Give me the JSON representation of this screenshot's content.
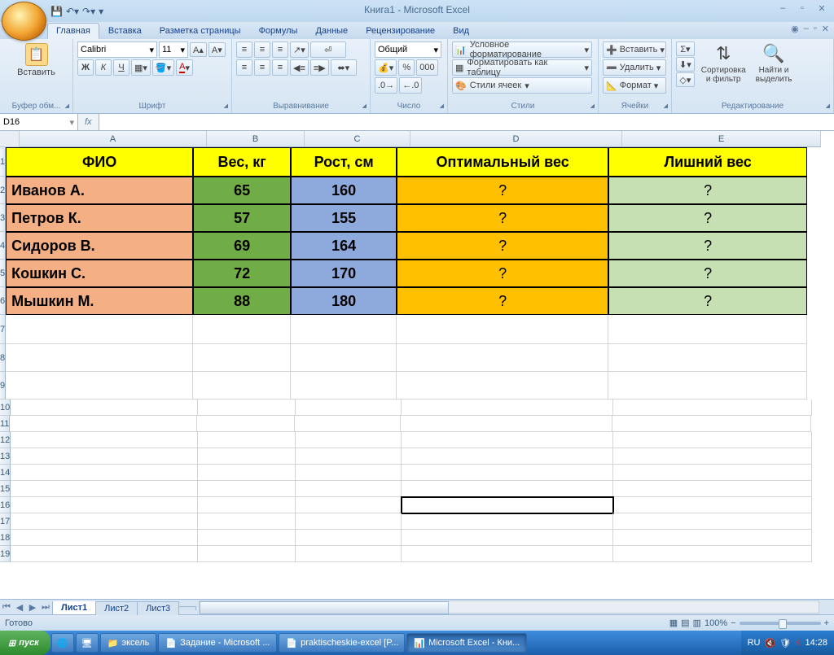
{
  "app": {
    "title": "Книга1 - Microsoft Excel"
  },
  "tabs": {
    "home": "Главная",
    "insert": "Вставка",
    "layout": "Разметка страницы",
    "formulas": "Формулы",
    "data": "Данные",
    "review": "Рецензирование",
    "view": "Вид"
  },
  "ribbon": {
    "clipboard": {
      "label": "Буфер обм...",
      "paste": "Вставить"
    },
    "font": {
      "label": "Шрифт",
      "family": "Calibri",
      "size": "11",
      "bold": "Ж",
      "italic": "К",
      "underline": "Ч"
    },
    "align": {
      "label": "Выравнивание"
    },
    "number": {
      "label": "Число",
      "format": "Общий"
    },
    "styles": {
      "label": "Стили",
      "cond": "Условное форматирование",
      "table": "Форматировать как таблицу",
      "cell": "Стили ячеек"
    },
    "cells": {
      "label": "Ячейки",
      "insert": "Вставить",
      "delete": "Удалить",
      "format": "Формат"
    },
    "editing": {
      "label": "Редактирование",
      "sort": "Сортировка\nи фильтр",
      "find": "Найти и\nвыделить"
    }
  },
  "namebox": "D16",
  "columns": [
    "A",
    "B",
    "C",
    "D",
    "E"
  ],
  "headers": {
    "a": "ФИО",
    "b": "Вес, кг",
    "c": "Рост, см",
    "d": "Оптимальный вес",
    "e": "Лишний вес"
  },
  "rows": [
    {
      "name": "Иванов А.",
      "w": "65",
      "h": "160",
      "opt": "?",
      "ext": "?"
    },
    {
      "name": "Петров К.",
      "w": "57",
      "h": "155",
      "opt": "?",
      "ext": "?"
    },
    {
      "name": "Сидоров В.",
      "w": "69",
      "h": "164",
      "opt": "?",
      "ext": "?"
    },
    {
      "name": "Кошкин С.",
      "w": "72",
      "h": "170",
      "opt": "?",
      "ext": "?"
    },
    {
      "name": "Мышкин М.",
      "w": "88",
      "h": "180",
      "opt": "?",
      "ext": "?"
    }
  ],
  "sheets": {
    "s1": "Лист1",
    "s2": "Лист2",
    "s3": "Лист3"
  },
  "status": {
    "ready": "Готово",
    "zoom": "100%"
  },
  "taskbar": {
    "start": "пуск",
    "items": [
      "эксель",
      "Задание - Microsoft ...",
      "praktischeskie-excel [P...",
      "Microsoft Excel - Кни..."
    ],
    "lang": "RU",
    "time": "14:28"
  }
}
